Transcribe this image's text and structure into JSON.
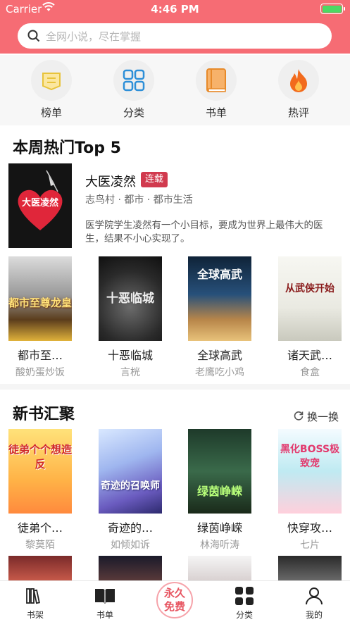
{
  "status": {
    "carrier": "Carrier",
    "time": "4:46 PM"
  },
  "search": {
    "placeholder": "全网小说，尽在掌握"
  },
  "quick": [
    {
      "label": "榜单",
      "icon": "ranking-icon"
    },
    {
      "label": "分类",
      "icon": "category-icon"
    },
    {
      "label": "书单",
      "icon": "booklist-icon"
    },
    {
      "label": "热评",
      "icon": "fire-icon"
    }
  ],
  "hot": {
    "title": "本周热门Top 5",
    "featured": {
      "cover_text": "大医凌然",
      "title": "大医凌然",
      "badge": "连载",
      "meta": "志鸟村 · 都市 · 都市生活",
      "desc": "医学院学生凌然有一个小目标，要成为世界上最伟大的医生，结果不小心实现了。"
    },
    "books": [
      {
        "title": "都市至…",
        "author": "酸奶蛋炒饭",
        "cover_text": "都市至尊龙皇"
      },
      {
        "title": "十恶临城",
        "author": "言桄",
        "cover_text": "十恶临城"
      },
      {
        "title": "全球高武",
        "author": "老鹰吃小鸡",
        "cover_text": "全球高武"
      },
      {
        "title": "诸天武…",
        "author": "食盒",
        "cover_text": "从武侠开始"
      }
    ]
  },
  "new": {
    "title": "新书汇聚",
    "swap": "换一换",
    "books": [
      {
        "title": "徒弟个…",
        "author": "黎莫陌",
        "cover_text": "徒弟个个想造反"
      },
      {
        "title": "奇迹的…",
        "author": "如倾如诉",
        "cover_text": "奇迹的召唤师"
      },
      {
        "title": "绿茵峥嵘",
        "author": "林海听涛",
        "cover_text": "绿茵峥嵘"
      },
      {
        "title": "快穿攻…",
        "author": "七片",
        "cover_text": "黑化BOSS极致宠"
      }
    ]
  },
  "tabs": [
    {
      "label": "书架",
      "icon": "bookshelf-icon"
    },
    {
      "label": "书单",
      "icon": "open-book-icon"
    },
    {
      "label": "分类",
      "icon": "grid-icon"
    },
    {
      "label": "我的",
      "icon": "user-icon"
    }
  ],
  "free_badge": {
    "line1": "永久",
    "line2": "免费"
  },
  "colors": {
    "brand": "#f66c74",
    "badge": "#d13a4e"
  }
}
